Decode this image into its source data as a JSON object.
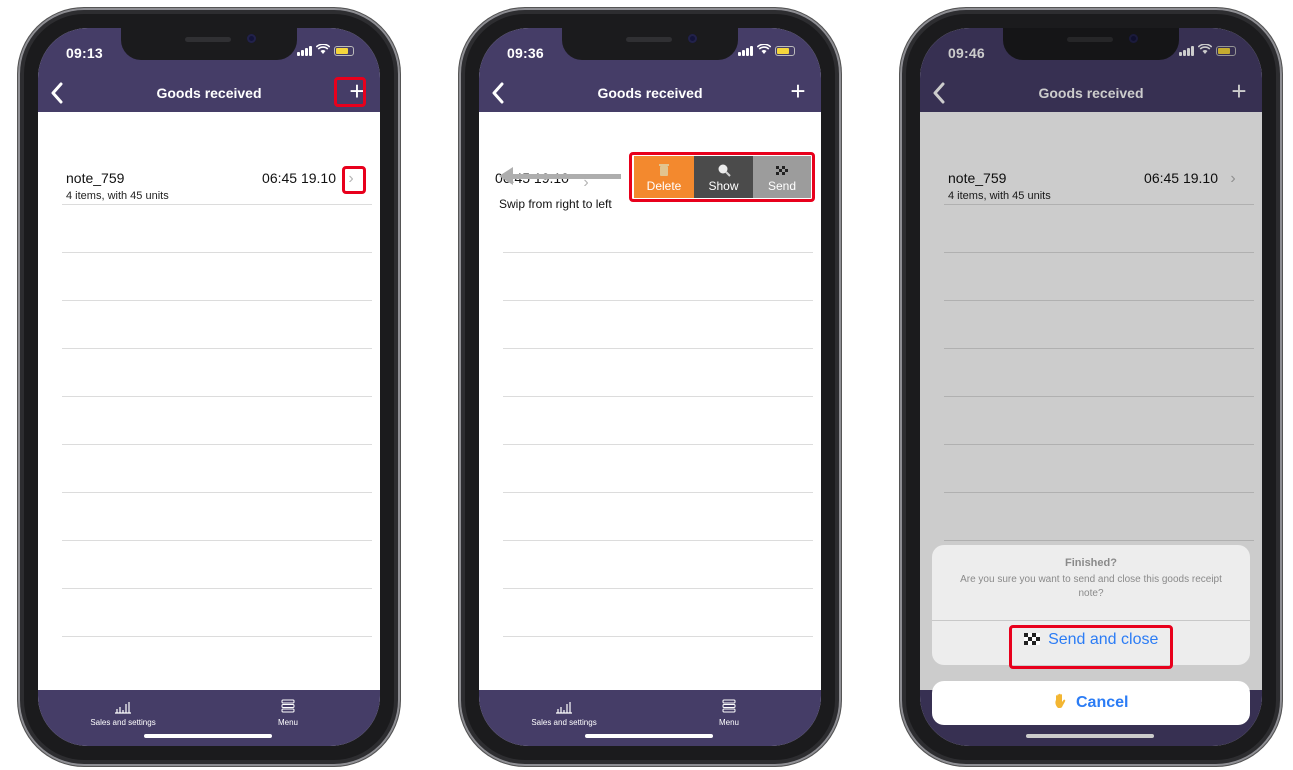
{
  "phone1": {
    "status": {
      "time": "09:13"
    },
    "nav": {
      "back_icon": "‹",
      "title": "Goods received",
      "add_icon": "+"
    },
    "note": {
      "name": "note_759",
      "meta": "4 items, with 45 units",
      "date": "06:45 19.10",
      "chevron": "›"
    },
    "tabbar": {
      "sales_label": "Sales and settings",
      "menu_label": "Menu"
    }
  },
  "phone2": {
    "status": {
      "time": "09:36"
    },
    "nav": {
      "back_icon": "‹",
      "title": "Goods received",
      "add_icon": "+"
    },
    "note": {
      "date": "06:45 19.10",
      "chevron": "›"
    },
    "swipe_hint": "Swip from right to left",
    "actions": {
      "delete_label": "Delete",
      "show_label": "Show",
      "send_label": "Send"
    },
    "tabbar": {
      "sales_label": "Sales and settings",
      "menu_label": "Menu"
    }
  },
  "phone3": {
    "status": {
      "time": "09:46"
    },
    "nav": {
      "back_icon": "‹",
      "title": "Goods received",
      "add_icon": "+"
    },
    "note": {
      "name": "note_759",
      "meta": "4 items, with 45 units",
      "date": "06:45 19.10",
      "chevron": "›"
    },
    "dialog": {
      "title": "Finished?",
      "message": "Are you sure you want to send and close this goods receipt note?",
      "confirm_label": "Send and close",
      "cancel_label": "Cancel"
    }
  },
  "colors": {
    "header_bg": "#453d67",
    "highlight": "#e8001c",
    "delete_bg": "#f3892e",
    "show_bg": "#4b4b4b",
    "send_bg": "#9c9c9c",
    "link_blue": "#2b7cf5"
  },
  "icons": [
    "chevron-left-icon",
    "plus-icon",
    "chevron-right-icon",
    "signal-icon",
    "wifi-icon",
    "battery-icon",
    "chart-icon",
    "menu-icon",
    "trash-icon",
    "magnifier-icon",
    "checkered-flag-icon",
    "hand-icon"
  ]
}
